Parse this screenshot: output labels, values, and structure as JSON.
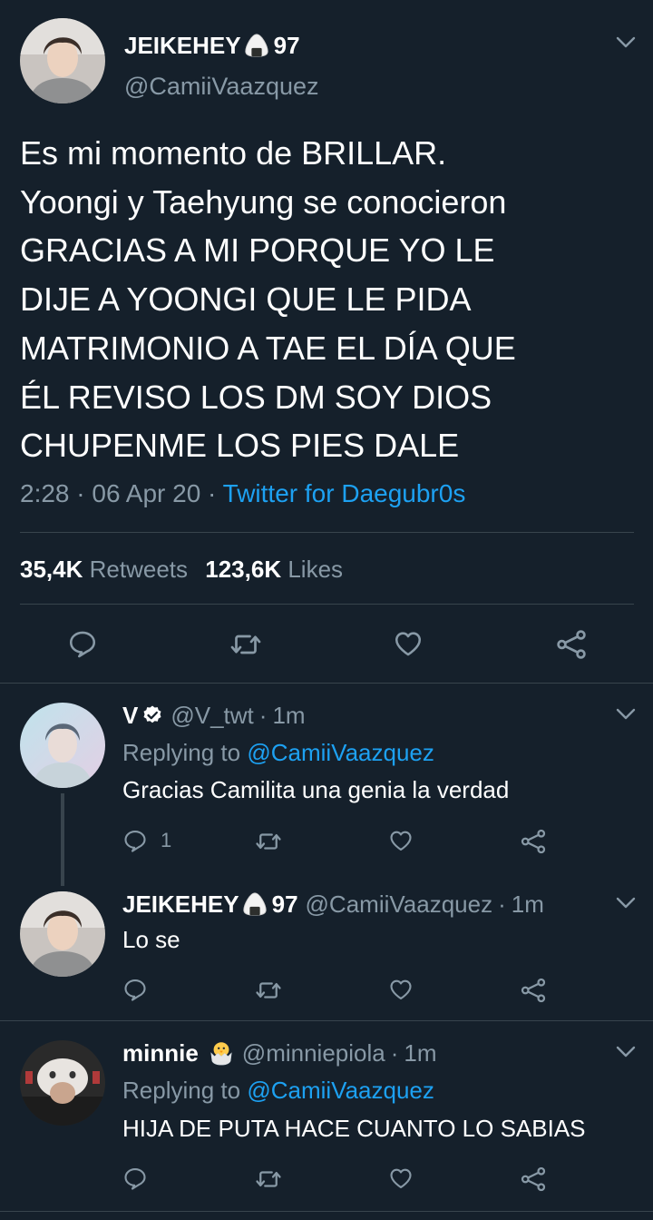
{
  "main_tweet": {
    "author_name": "JEIKEHEY",
    "author_suffix": "97",
    "handle": "@CamiiVaazquez",
    "text_lines": [
      "Es mi momento de BRILLAR.",
      "Yoongi y Taehyung se conocieron",
      "GRACIAS A MI PORQUE YO LE",
      "DIJE A YOONGI QUE LE PIDA",
      "MATRIMONIO A TAE EL DÍA QUE",
      "ÉL REVISO LOS DM SOY DIOS",
      "CHUPENME LOS PIES DALE"
    ],
    "time": "2:28",
    "date": "06 Apr 20",
    "source": "Twitter for Daegubr0s",
    "retweets_count": "35,4K",
    "retweets_label": "Retweets",
    "likes_count": "123,6K",
    "likes_label": "Likes"
  },
  "replies": [
    {
      "name": "V",
      "handle": "@V_twt",
      "time": "1m",
      "replying_prefix": "Replying to",
      "replying_to": "@CamiiVaazquez",
      "text": "Gracias Camilita una genia la verdad",
      "reply_count": "1"
    },
    {
      "name": "JEIKEHEY",
      "name_suffix": "97",
      "handle": "@CamiiVaazquez",
      "time": "1m",
      "text": "Lo se"
    },
    {
      "name": "minnie",
      "handle": "@minniepiola",
      "time": "1m",
      "replying_prefix": "Replying to",
      "replying_to": "@CamiiVaazquez",
      "text": "HIJA DE PUTA HACE CUANTO LO SABIAS"
    }
  ],
  "separator": "·",
  "colors": {
    "background": "#15202b",
    "text": "#ffffff",
    "muted": "#8899a6",
    "link": "#1da1f2",
    "divider": "#38444d"
  },
  "icons": [
    "chevron-down-icon",
    "reply-icon",
    "retweet-icon",
    "like-icon",
    "share-icon",
    "verified-icon",
    "rice-ball-emoji",
    "hatching-chick-emoji"
  ]
}
